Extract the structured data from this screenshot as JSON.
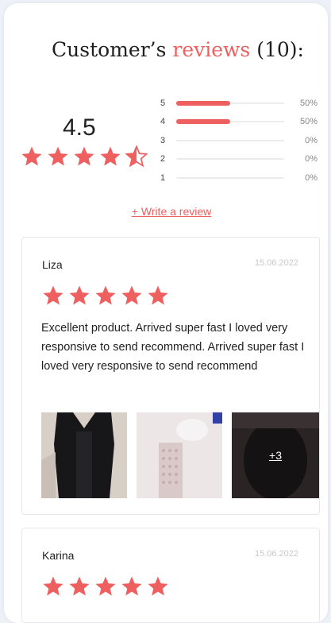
{
  "header": {
    "title_prefix": "Customer’s ",
    "title_accent": "reviews",
    "title_count": " (10):"
  },
  "summary": {
    "rating": "4.5",
    "stars_filled": 4.5,
    "distribution": [
      {
        "star": "5",
        "percent_label": "50%",
        "fraction": 0.5
      },
      {
        "star": "4",
        "percent_label": "50%",
        "fraction": 0.5
      },
      {
        "star": "3",
        "percent_label": "0%",
        "fraction": 0
      },
      {
        "star": "2",
        "percent_label": "0%",
        "fraction": 0
      },
      {
        "star": "1",
        "percent_label": "0%",
        "fraction": 0
      }
    ]
  },
  "write_review_label": "+ Write a review",
  "reviews": [
    {
      "name": "Liza",
      "date": "15.06.2022",
      "stars": 5,
      "text": "Excellent product. Arrived super fast I loved very responsive to send recommend. Arrived super fast I loved very responsive to send recommend",
      "more_photos": "+3"
    },
    {
      "name": "Karina",
      "date": "15.06.2022",
      "stars": 5
    }
  ],
  "colors": {
    "accent": "#ee6060",
    "text": "#222222",
    "muted": "#c8c8c8"
  }
}
